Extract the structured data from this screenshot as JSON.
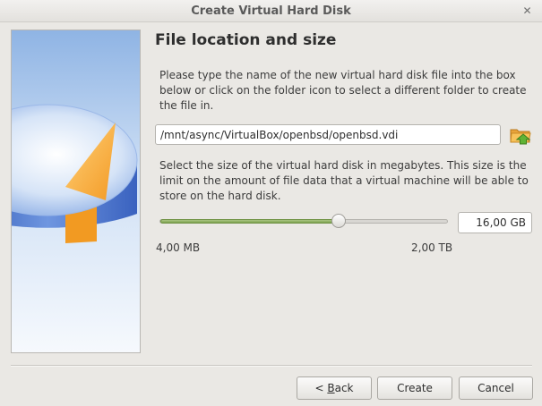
{
  "window": {
    "title": "Create Virtual Hard Disk",
    "close_glyph": "✕"
  },
  "page": {
    "title": "File location and size",
    "location_description": "Please type the name of the new virtual hard disk file into the box below or click on the folder icon to select a different folder to create the file in.",
    "size_description": "Select the size of the virtual hard disk in megabytes. This size is the limit on the amount of file data that a virtual machine will be able to store on the hard disk."
  },
  "location": {
    "path": "/mnt/async/VirtualBox/openbsd/openbsd.vdi",
    "folder_icon": "folder-open-icon"
  },
  "size": {
    "value": "16,00 GB",
    "min_label": "4,00 MB",
    "max_label": "2,00 TB",
    "slider_position": 0.625
  },
  "buttons": {
    "back_prefix": "< ",
    "back_mnemonic": "B",
    "back_rest": "ack",
    "create": "Create",
    "cancel": "Cancel"
  },
  "colors": {
    "slider_fill": "#8bad5e",
    "side_panel": "#8fb4e4"
  }
}
